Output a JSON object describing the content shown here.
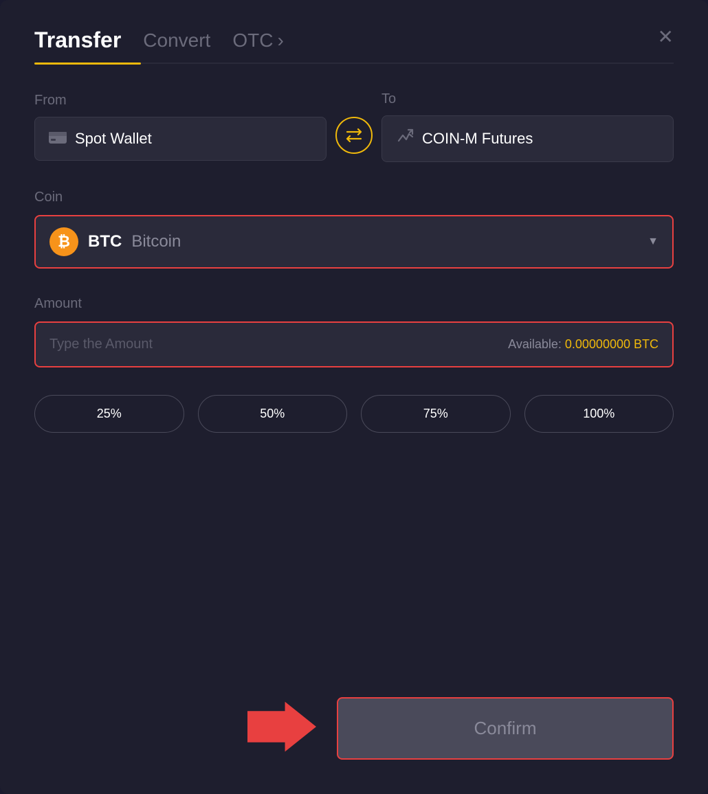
{
  "header": {
    "tab_transfer": "Transfer",
    "tab_convert": "Convert",
    "tab_otc": "OTC",
    "tab_otc_chevron": "›",
    "close_label": "✕"
  },
  "from": {
    "label": "From",
    "wallet_icon": "▬",
    "wallet_name": "Spot Wallet"
  },
  "swap": {
    "icon": "⇄"
  },
  "to": {
    "label": "To",
    "wallet_icon": "↑",
    "wallet_name": "COIN-M Futures"
  },
  "coin": {
    "label": "Coin",
    "symbol": "BTC",
    "name": "Bitcoin",
    "chevron": "▼"
  },
  "amount": {
    "label": "Amount",
    "placeholder": "Type the Amount",
    "available_label": "Available:",
    "available_value": "0.00000000 BTC"
  },
  "percentages": [
    {
      "label": "25%"
    },
    {
      "label": "50%"
    },
    {
      "label": "75%"
    },
    {
      "label": "100%"
    }
  ],
  "confirm": {
    "label": "Confirm"
  }
}
